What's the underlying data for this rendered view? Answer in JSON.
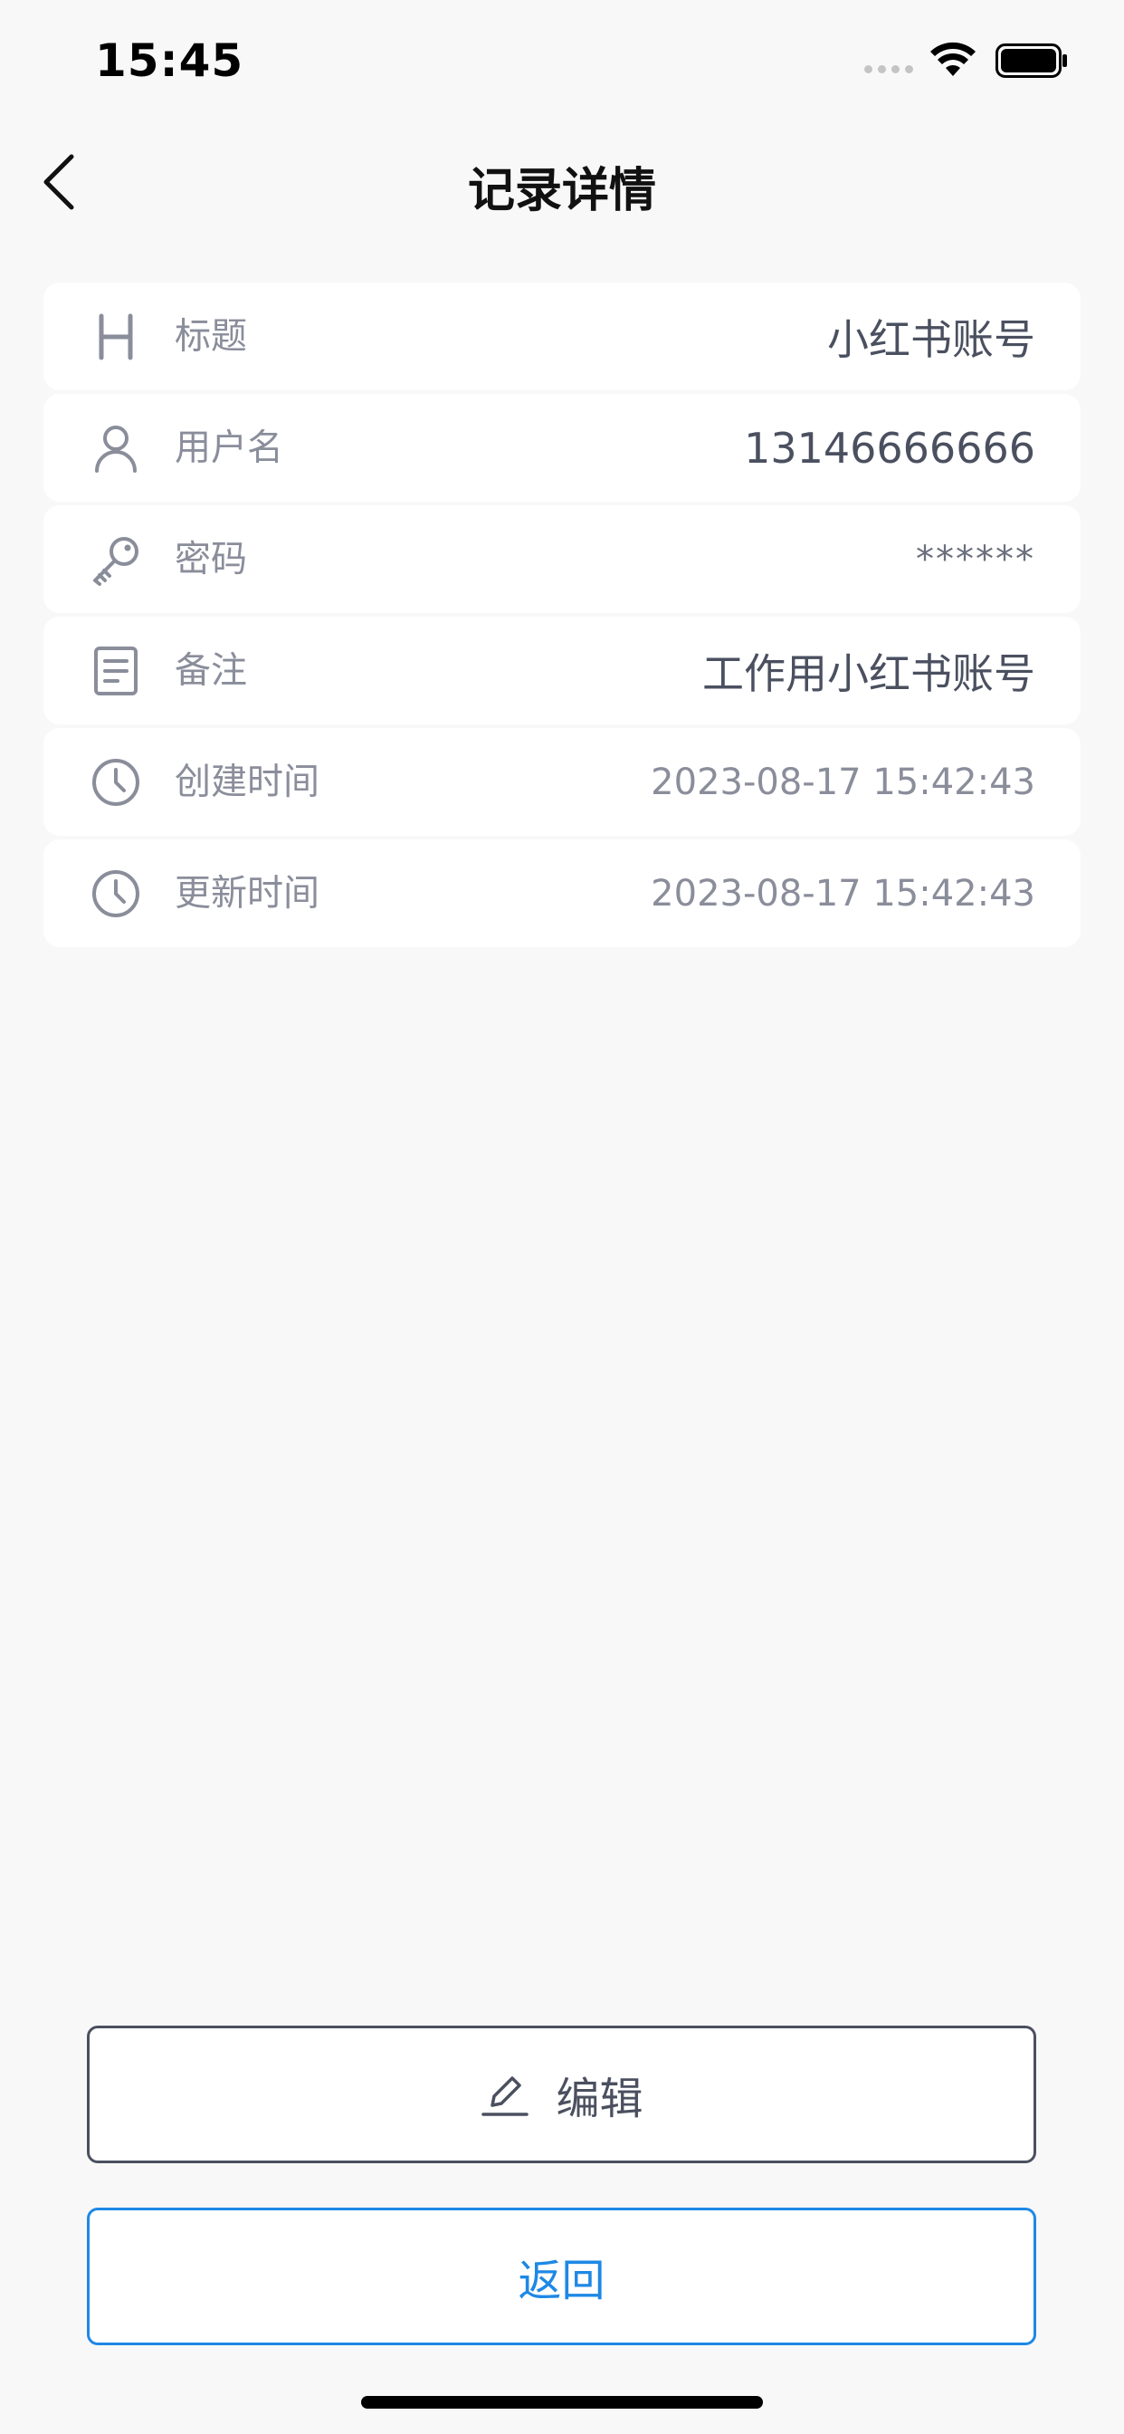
{
  "status_bar": {
    "time": "15:45"
  },
  "nav": {
    "title": "记录详情"
  },
  "details": {
    "title_row": {
      "label": "标题",
      "value": "小红书账号",
      "icon": "heading-icon"
    },
    "username_row": {
      "label": "用户名",
      "value": "13146666666",
      "icon": "user-icon"
    },
    "password_row": {
      "label": "密码",
      "value": "******",
      "icon": "key-icon"
    },
    "note_row": {
      "label": "备注",
      "value": "工作用小红书账号",
      "icon": "document-icon"
    },
    "created_row": {
      "label": "创建时间",
      "value": "2023-08-17 15:42:43",
      "icon": "clock-icon"
    },
    "updated_row": {
      "label": "更新时间",
      "value": "2023-08-17 15:42:43",
      "icon": "clock-icon"
    }
  },
  "actions": {
    "edit_label": "编辑",
    "back_label": "返回"
  },
  "colors": {
    "background": "#f8f8f8",
    "card": "#ffffff",
    "icon_gray": "#8a8d9a",
    "text_dark": "#4b5060",
    "accent_blue": "#1e88e5"
  }
}
